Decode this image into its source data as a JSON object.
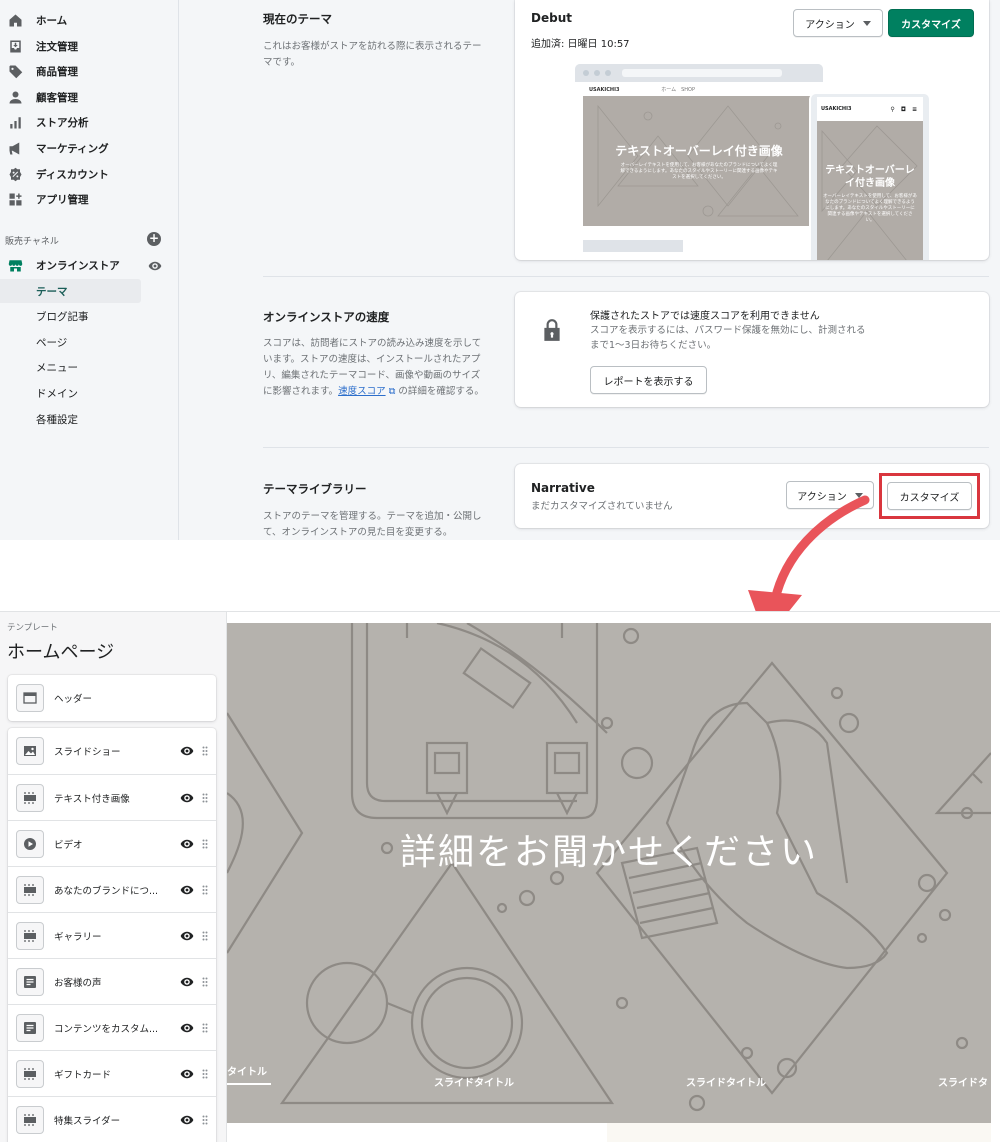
{
  "sidebar": {
    "nav": [
      {
        "label": "ホーム",
        "icon": "home-icon"
      },
      {
        "label": "注文管理",
        "icon": "orders-icon"
      },
      {
        "label": "商品管理",
        "icon": "tag-icon"
      },
      {
        "label": "顧客管理",
        "icon": "person-icon"
      },
      {
        "label": "ストア分析",
        "icon": "analytics-icon"
      },
      {
        "label": "マーケティング",
        "icon": "megaphone-icon"
      },
      {
        "label": "ディスカウント",
        "icon": "discount-icon"
      },
      {
        "label": "アプリ管理",
        "icon": "apps-icon"
      }
    ],
    "channels_label": "販売チャネル",
    "online_store": "オンラインストア",
    "sub_items": [
      "テーマ",
      "ブログ記事",
      "ページ",
      "メニュー",
      "ドメイン",
      "各種設定"
    ]
  },
  "current_theme": {
    "title": "現在のテーマ",
    "desc": "これはお客様がストアを訪れる際に表示されるテーマです。",
    "name": "Debut",
    "added": "追加済: 日曜日 10:57",
    "action_label": "アクション",
    "customize_label": "カスタマイズ",
    "preview": {
      "brand": "USAKICHI3",
      "nav_links": "ホーム　SHOP",
      "hero_title": "テキストオーバーレイ付き画像",
      "hero_sub": "オーバーレイテキストを使用して、お客様があなたのブランドについてよく理解できるようにします。あなたのスタイルやストーリーに関連する画像やテキストを選択してください。",
      "mobile_title": "テキストオーバーレイ付き画像",
      "mobile_sub": "オーバーレイテキストを使用して、お客様があなたのブランドについてよく理解できるようにします。あなたのスタイルやストーリーに関連する画像やテキストを選択してください。"
    }
  },
  "speed": {
    "title": "オンラインストアの速度",
    "desc_pre": "スコアは、訪問者にストアの読み込み速度を示しています。ストアの速度は、インストールされたアプリ、編集されたテーマコード、画像や動画のサイズに影響されます。",
    "link": "速度スコア",
    "desc_post": " の詳細を確認する。",
    "card_title": "保護されたストアでは速度スコアを利用できません",
    "card_desc": "スコアを表示するには、パスワード保護を無効にし、計測されるまで1〜3日お待ちください。",
    "report_label": "レポートを表示する"
  },
  "library": {
    "title": "テーマライブラリー",
    "desc": "ストアのテーマを管理する。テーマを追加・公開して、オンラインストアの見た目を変更する。",
    "theme_name": "Narrative",
    "status": "まだカスタマイズされていません",
    "action_label": "アクション",
    "customize_label": "カスタマイズ"
  },
  "editor": {
    "template_label": "テンプレート",
    "template_name": "ホームページ",
    "header_block": "ヘッダー",
    "blocks": [
      {
        "label": "スライドショー",
        "icon": "image-icon"
      },
      {
        "label": "テキスト付き画像",
        "icon": "section-icon"
      },
      {
        "label": "ビデオ",
        "icon": "play-icon"
      },
      {
        "label": "あなたのブランドにつ...",
        "icon": "section-icon"
      },
      {
        "label": "ギャラリー",
        "icon": "section-icon"
      },
      {
        "label": "お客様の声",
        "icon": "text-block-icon"
      },
      {
        "label": "コンテンツをカスタム...",
        "icon": "text-block-icon"
      },
      {
        "label": "ギフトカード",
        "icon": "section-icon"
      },
      {
        "label": "特集スライダー",
        "icon": "section-icon"
      }
    ],
    "headline": "詳細をお聞かせください",
    "slide_tabs": [
      "タイトル",
      "スライドタイトル",
      "スライドタイトル",
      "スライドタ"
    ]
  },
  "colors": {
    "primary_green": "#008060",
    "highlight_red": "#d9363e",
    "arrow": "#e9545a",
    "hero_gray": "#b5b2ad"
  }
}
